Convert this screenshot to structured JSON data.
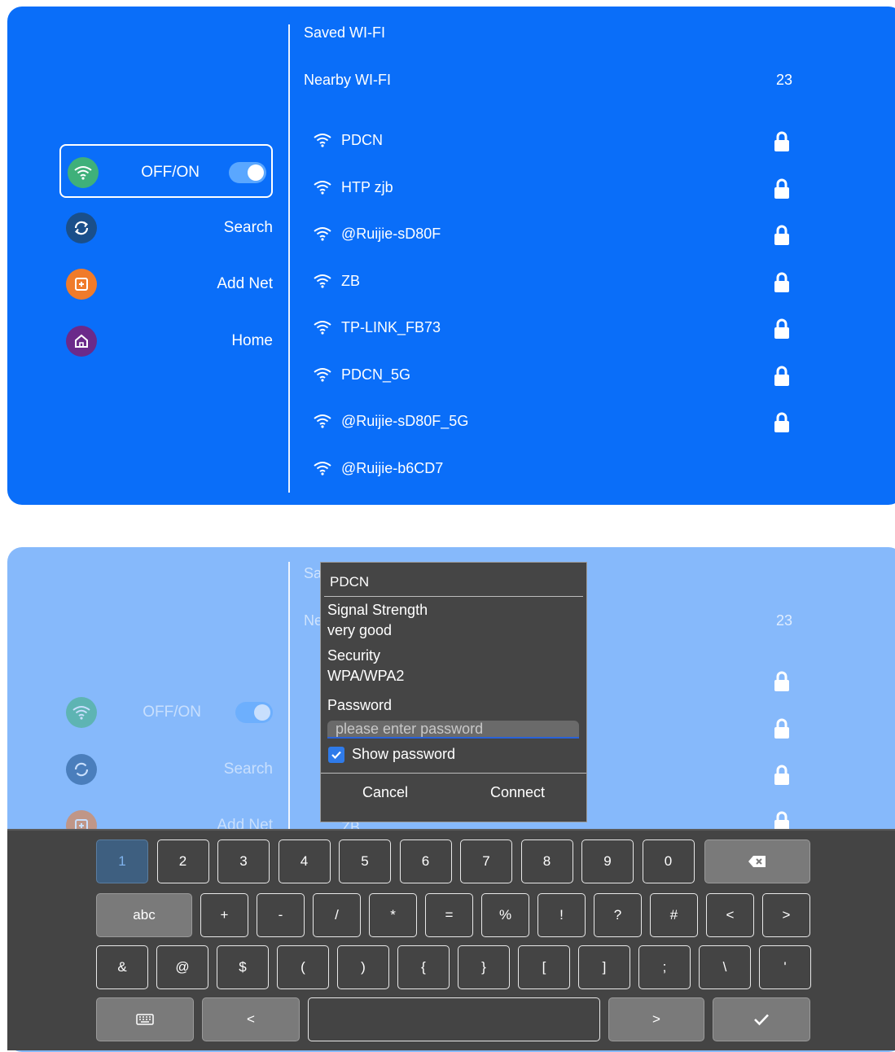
{
  "screen1": {
    "sidebar": {
      "items": [
        {
          "label": "OFF/ON",
          "icon": "wifi-icon",
          "color": "#3fb07a"
        },
        {
          "label": "Search",
          "icon": "refresh-icon",
          "color": "#1a4f8a"
        },
        {
          "label": "Add Net",
          "icon": "add-square-icon",
          "color": "#f07b2a"
        },
        {
          "label": "Home",
          "icon": "home-icon",
          "color": "#6b2a8a"
        }
      ]
    },
    "saved_title": "Saved WI-FI",
    "nearby_title": "Nearby WI-FI",
    "nearby_count": "23",
    "networks": [
      {
        "name": "PDCN",
        "locked": true
      },
      {
        "name": "HTP zjb",
        "locked": true
      },
      {
        "name": "@Ruijie-sD80F",
        "locked": true
      },
      {
        "name": "ZB",
        "locked": true
      },
      {
        "name": "TP-LINK_FB73",
        "locked": true
      },
      {
        "name": "PDCN_5G",
        "locked": true
      },
      {
        "name": "@Ruijie-sD80F_5G",
        "locked": true
      },
      {
        "name": "@Ruijie-b6CD7",
        "locked": false
      }
    ]
  },
  "screen2": {
    "sidebar": {
      "items": [
        {
          "label": "OFF/ON"
        },
        {
          "label": "Search"
        },
        {
          "label": "Add Net"
        }
      ]
    },
    "saved_title_partial": "Sa",
    "nearby_title_partial": "Ne",
    "nearby_count": "23",
    "network_name_partial": "ZB",
    "dialog": {
      "title": "PDCN",
      "signal_label": "Signal Strength",
      "signal_value": "very good",
      "security_label": "Security",
      "security_value": "WPA/WPA2",
      "password_label": "Password",
      "password_placeholder": "please enter password",
      "show_password_label": "Show password",
      "show_password_checked": true,
      "cancel_label": "Cancel",
      "connect_label": "Connect"
    },
    "keyboard": {
      "row1": [
        "1",
        "2",
        "3",
        "4",
        "5",
        "6",
        "7",
        "8",
        "9",
        "0"
      ],
      "row2_mode": "abc",
      "row2": [
        "+",
        "-",
        "/",
        "*",
        "=",
        "%",
        "!",
        "?",
        "#",
        "<",
        ">"
      ],
      "row3": [
        "&",
        "@",
        "$",
        "(",
        ")",
        "{",
        "}",
        "[",
        "]",
        ";",
        "\\",
        "'"
      ],
      "row4": {
        "hide_icon": "keyboard-icon",
        "left": "<",
        "right": ">",
        "enter_icon": "check-icon"
      },
      "backspace_icon": "backspace-icon"
    }
  }
}
